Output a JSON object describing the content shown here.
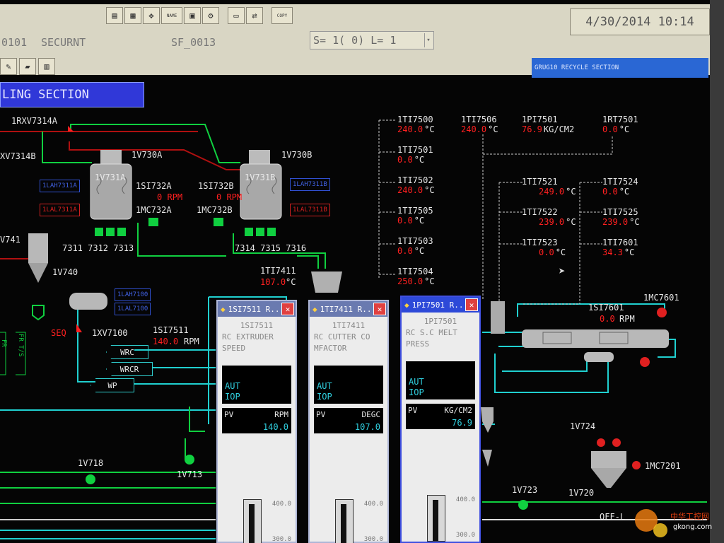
{
  "toolbar": {
    "datetime": "4/30/2014 10:14",
    "copy_label": "COPY",
    "name_label": "NAME",
    "row2": {
      "station": "0101",
      "mode": "SECURNT",
      "panel": "SF_0013",
      "s_label": "S= 1( 0) L= 1"
    },
    "window_title": "GRUG10 RECYCLE SECTION"
  },
  "section_title": "LING SECTION",
  "process": {
    "v7314a": "1RXV7314A",
    "v7314b": "XV7314B",
    "v730a": "1V730A",
    "v730b": "1V730B",
    "v731a": "1V731A",
    "v731b": "1V731B",
    "si732a": "1SI732A",
    "si732b": "1SI732B",
    "rpm_a": "0 RPM",
    "rpm_b": "0 RPM",
    "mc732a": "1MC732A",
    "mc732b": "1MC732B",
    "lah7311a": "1LAH7311A",
    "lal7311a": "1LAL7311A",
    "lah7311b": "1LAH7311B",
    "lal7311b": "1LAL7311B",
    "valves_a": "7311 7312 7313",
    "valves_b": "7314 7315 7316",
    "v741": "V741",
    "v740": "1V740",
    "lah7100": "1LAH7100",
    "lal7100": "1LAL7100",
    "seq": "SEQ",
    "xv7100": "1XV7100",
    "si7511": "1SI7511",
    "si7511_val": "140.0",
    "si7511_unit": "RPM",
    "wrc": "WRC",
    "wrcr": "WRCR",
    "wp": "WP",
    "ti7411": "1TI7411",
    "ti7411_val": "107.0",
    "deg": "°C",
    "v718": "1V718",
    "v713": "1V713",
    "v724": "1V724",
    "mc7201": "1MC7201",
    "v723": "1V723",
    "v720": "1V720",
    "off_l": "OFF-L",
    "mc7601": "1MC7601",
    "si7601": "1SI7601",
    "si7601_val": "0.0",
    "si7601_unit": "RPM",
    "fr": "FR",
    "fr_t": "FR T/S"
  },
  "readings_left": [
    {
      "tag": "1TI7500",
      "value": "240.0",
      "unit": "°C"
    },
    {
      "tag": "1TI7501",
      "value": "0.0",
      "unit": "°C"
    },
    {
      "tag": "1TI7502",
      "value": "240.0",
      "unit": "°C"
    },
    {
      "tag": "1TI7505",
      "value": "0.0",
      "unit": "°C"
    },
    {
      "tag": "1TI7503",
      "value": "0.0",
      "unit": "°C"
    },
    {
      "tag": "1TI7504",
      "value": "250.0",
      "unit": "°C"
    }
  ],
  "readings_top": [
    {
      "tag": "1TI7506",
      "value": "240.0",
      "unit": "°C"
    },
    {
      "tag": "1PI7501",
      "value": "76.9",
      "unit": "KG/CM2"
    },
    {
      "tag": "1RT7501",
      "value": "0.0",
      "unit": "°C"
    }
  ],
  "readings_mid": [
    {
      "tag": "1TI7521",
      "value": "249.0",
      "unit": "°C"
    },
    {
      "tag": "1TI7522",
      "value": "239.0",
      "unit": "°C"
    },
    {
      "tag": "1TI7523",
      "value": "0.0",
      "unit": "°C"
    }
  ],
  "readings_right": [
    {
      "tag": "1TI7524",
      "value": "0.0",
      "unit": "°C"
    },
    {
      "tag": "1TI7525",
      "value": "239.0",
      "unit": "°C"
    },
    {
      "tag": "1TI7601",
      "value": "34.3",
      "unit": "°C"
    }
  ],
  "faceplates": [
    {
      "title": "1SI7511 R...",
      "tag": "1SI7511",
      "desc": "RC EXTRUDER SPEED",
      "mode1": "AUT",
      "mode2": "IOP",
      "pv_label": "PV",
      "unit": "RPM",
      "value": "140.0",
      "scale_hi": "400.0",
      "scale_lo": "300.0"
    },
    {
      "title": "1TI7411 R...",
      "tag": "1TI7411",
      "desc": "RC CUTTER CO MFACTOR",
      "mode1": "AUT",
      "mode2": "IOP",
      "pv_label": "PV",
      "unit": "DEGC",
      "value": "107.0",
      "scale_hi": "400.0",
      "scale_lo": "300.0"
    },
    {
      "title": "1PI7501 R...",
      "tag": "1PI7501",
      "desc": "RC S.C MELT PRESS",
      "mode1": "AUT",
      "mode2": "IOP",
      "pv_label": "PV",
      "unit": "KG/CM2",
      "value": "76.9",
      "scale_hi": "400.0",
      "scale_lo": "300.0"
    }
  ],
  "watermark": {
    "line1": "中华工控网",
    "line2": "gkong.com"
  },
  "colors": {
    "pipe_green": "#10d040",
    "pipe_cyan": "#20d0d0",
    "pipe_red": "#b01010",
    "value_red": "#ff2020",
    "title_blue": "#3038d8"
  }
}
